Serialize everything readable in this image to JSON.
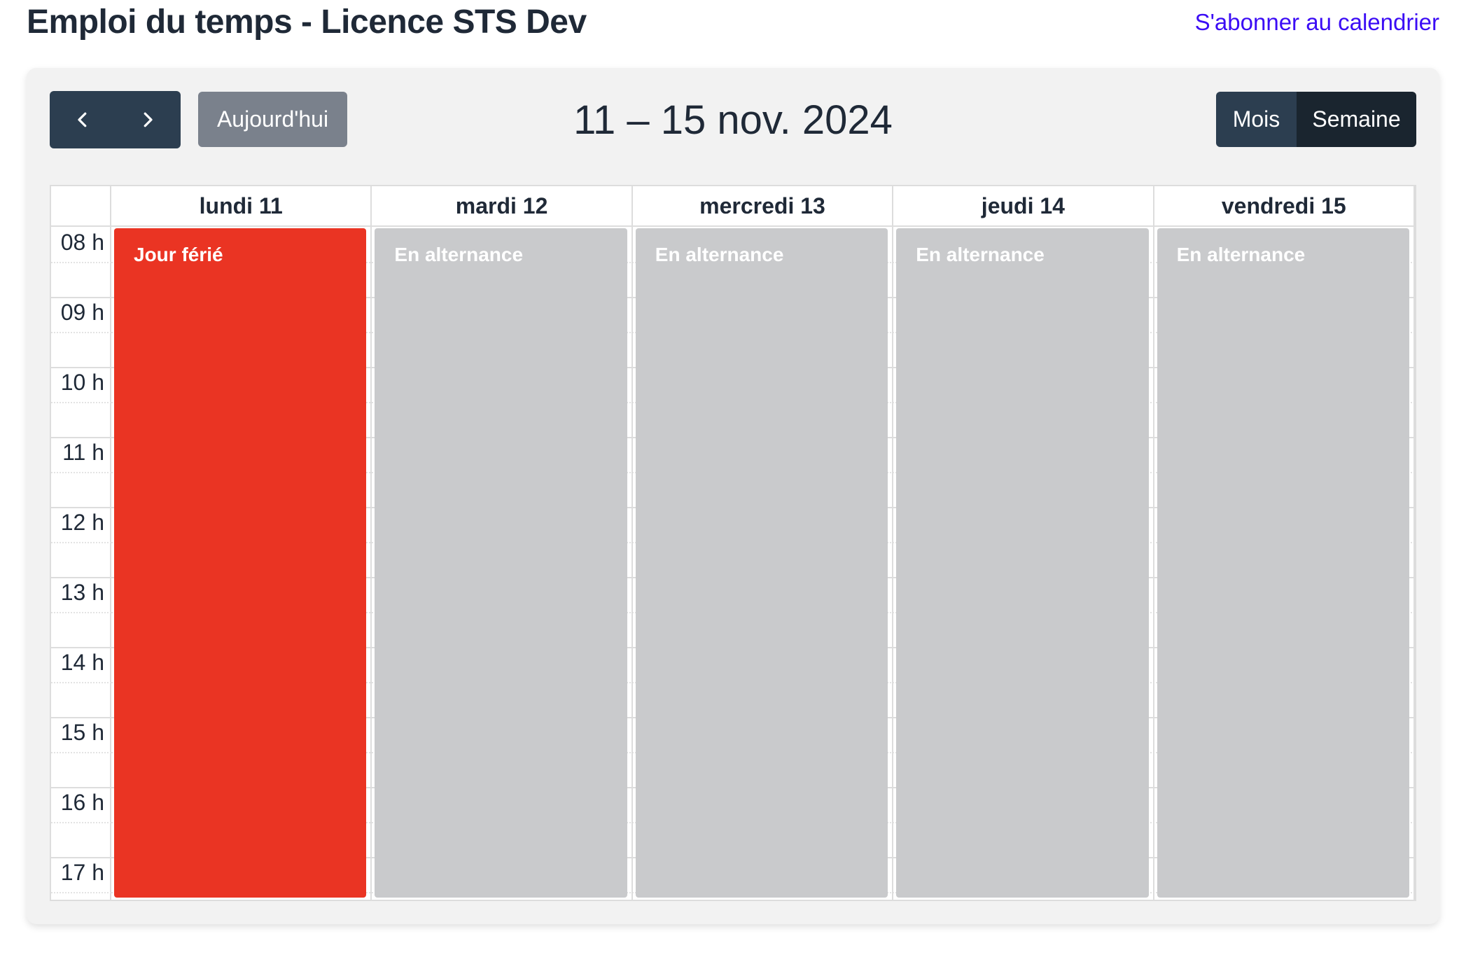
{
  "header": {
    "title": "Emploi du temps - Licence STS Dev",
    "subscribe_link": "S'abonner au calendrier"
  },
  "toolbar": {
    "prev_icon": "chevron-left-icon",
    "next_icon": "chevron-right-icon",
    "today_label": "Aujourd'hui",
    "range_title": "11 – 15 nov. 2024",
    "view_month": "Mois",
    "view_week": "Semaine",
    "active_view": "Semaine"
  },
  "calendar": {
    "days": [
      "lundi 11",
      "mardi 12",
      "mercredi 13",
      "jeudi 14",
      "vendredi 15"
    ],
    "hours": [
      "08 h",
      "09 h",
      "10 h",
      "11 h",
      "12 h",
      "13 h",
      "14 h",
      "15 h",
      "16 h",
      "17 h"
    ],
    "events": [
      {
        "day": "lundi 11",
        "title": "Jour férié",
        "color": "#ea3423"
      },
      {
        "day": "mardi 12",
        "title": "En alternance",
        "color": "#c9cacc"
      },
      {
        "day": "mercredi 13",
        "title": "En alternance",
        "color": "#c9cacc"
      },
      {
        "day": "jeudi 14",
        "title": "En alternance",
        "color": "#c9cacc"
      },
      {
        "day": "vendredi 15",
        "title": "En alternance",
        "color": "#c9cacc"
      }
    ]
  },
  "colors": {
    "nav_button": "#2c3e50",
    "active_view_button": "#1a252f",
    "today_button": "#7a818c",
    "link": "#3b0cf5",
    "holiday": "#ea3423",
    "alternance": "#c9cacc"
  }
}
